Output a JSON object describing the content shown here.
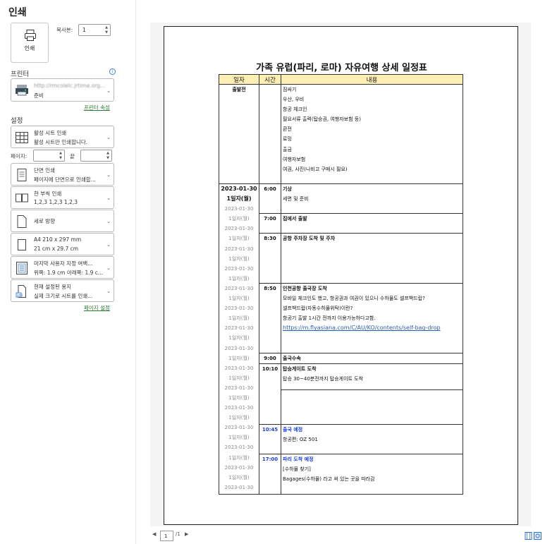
{
  "header": {
    "title": "인쇄"
  },
  "print_button": {
    "label": "인쇄"
  },
  "copies": {
    "label": "복사본:",
    "value": "1"
  },
  "printer": {
    "section": "프린터",
    "name": "http://rmcolelc.jrtime.org...",
    "status": "준비",
    "properties_link": "프린터 속성"
  },
  "settings": {
    "section": "설정",
    "print_what": {
      "title": "활성 시트 인쇄",
      "desc": "활성 시트만 인쇄합니다."
    },
    "pages": {
      "label": "페이지:",
      "to_label": "끝"
    },
    "sides": {
      "title": "단면 인쇄",
      "desc": "페이지에 단면으로 인쇄합..."
    },
    "collation": {
      "title": "한 부씩 인쇄",
      "desc": "1,2,3     1,2,3     1,2,3"
    },
    "orientation": {
      "title": "세로 방향"
    },
    "paper": {
      "title": "A4 210 x 297 mm",
      "desc": "21 cm x 29.7 cm"
    },
    "margins": {
      "title": "마지막 사용자 지정 여백...",
      "desc": "위쪽: 1.9 cm 아래쪽: 1.9 c..."
    },
    "scaling": {
      "title": "현재 설정된 용지",
      "desc": "실제 크기로 시트를 인쇄..."
    },
    "page_setup_link": "페이지 설정"
  },
  "document": {
    "title": "가족 유럽(파리, 로마) 자유여행 상세 일정표",
    "headers": {
      "date": "일자",
      "time": "시간",
      "content": "내용"
    },
    "prep": {
      "date": "출발전",
      "items": [
        "짐싸기",
        "우산, 우비",
        "항공 체크인",
        "필요서류 출력(탑승권, 여행자보험 등)",
        "환전",
        "로밍",
        "출금",
        "여행자보험",
        "여권, 사진(나비고 구매시 필요)"
      ]
    },
    "day1": {
      "date": "2023-01-30",
      "day": "1일자(월)",
      "date_small": "2023-01-30",
      "day_small": "1일자(월)",
      "e1_time": "6:00",
      "e1_title": "기상",
      "e1_desc": "세면 및 준비",
      "e2_time": "7:00",
      "e2_title": "집에서 출발",
      "e3_time": "8:30",
      "e3_title": "공항 주차장 도착 및 주차",
      "e4_time": "8:50",
      "e4_title": "인천공항 출국장 도착",
      "e4_l1": "모바일 체크인도 했고, 항공권과 여권이 있으니 수하물도 셀프백드랍?",
      "e4_l2": "셀프백드랍(자동수하물위탁)이란?",
      "e4_l3": "항공기 출발 1시간 전까지 이용가능하다고함.",
      "e4_url": "https://m.flyasiana.com/C/AU/KO/contents/self-bag-drop",
      "e5_time": "9:00",
      "e5_title": "출국수속",
      "e6_time": "10:10",
      "e6_title": "탑승게이트 도착",
      "e6_desc": "탑승 30~40분전까지 탑승게이트 도착",
      "e7_time": "10:45",
      "e7_title": "출국 예정",
      "e7_desc": "항공편: OZ 501",
      "e8_time": "17:00",
      "e8_title": "파리 도착 예정",
      "e8_l1": "[수하물 찾기]",
      "e8_l2": "Bagages(수하물) 라고 써 있는 곳을 따라감"
    }
  },
  "pager": {
    "current": "1",
    "total": "/1"
  },
  "colors": {
    "header_fill": "#fdeeb4",
    "blue_text": "#1a3de0",
    "link_green": "#2e7d32"
  }
}
